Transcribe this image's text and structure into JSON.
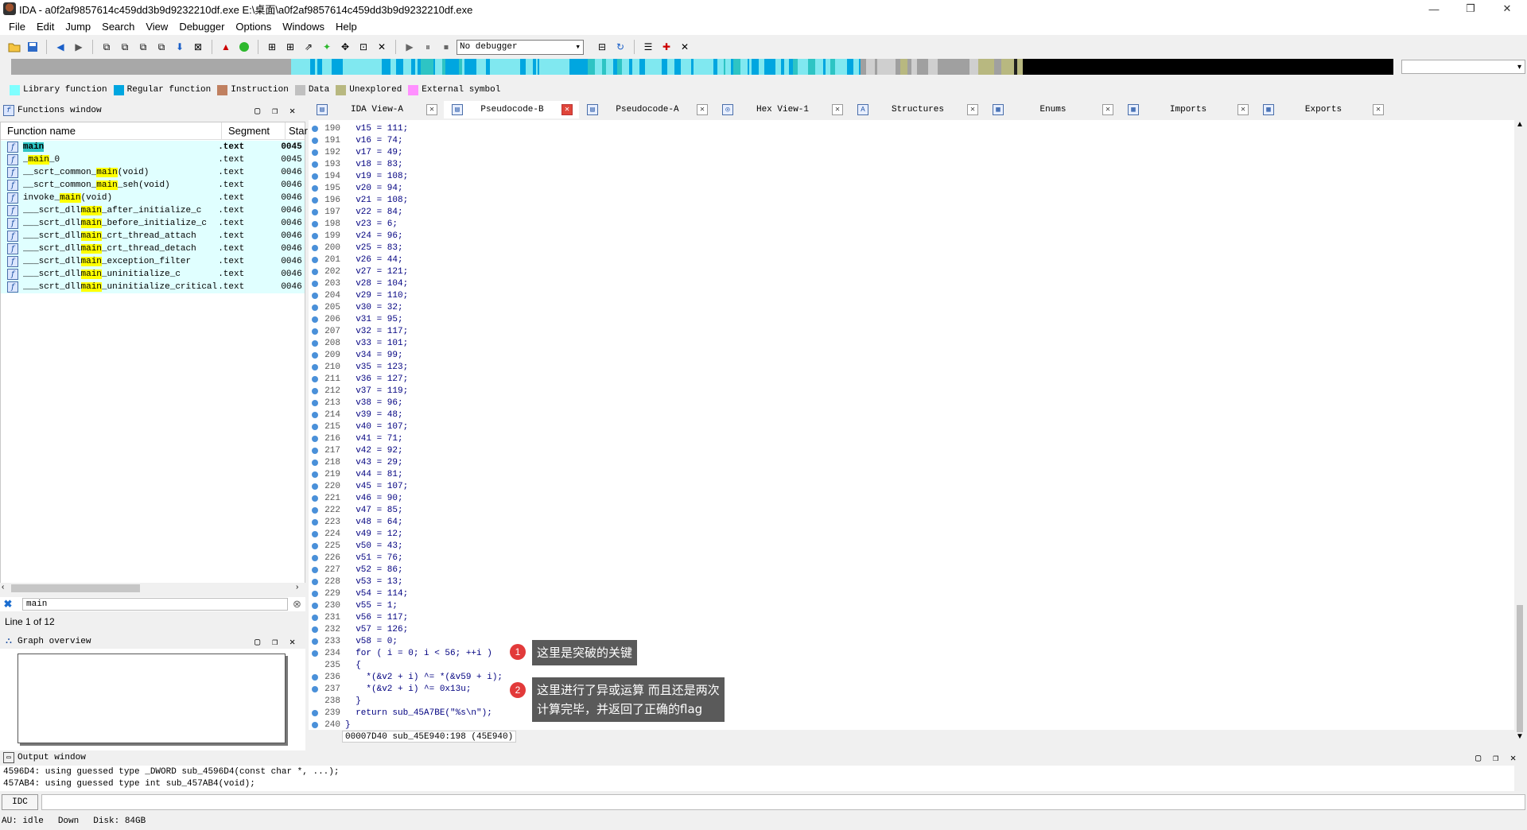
{
  "window": {
    "title": "IDA - a0f2af9857614c459dd3b9d9232210df.exe E:\\桌面\\a0f2af9857614c459dd3b9d9232210df.exe",
    "minimize": "—",
    "restore": "❐",
    "close": "✕"
  },
  "menu": [
    "File",
    "Edit",
    "Jump",
    "Search",
    "View",
    "Debugger",
    "Options",
    "Windows",
    "Help"
  ],
  "toolbar": {
    "debugger_select": "No debugger"
  },
  "legend": [
    {
      "label": "Library function",
      "color": "#80ffff"
    },
    {
      "label": "Regular function",
      "color": "#00a6e0"
    },
    {
      "label": "Instruction",
      "color": "#c08060"
    },
    {
      "label": "Data",
      "color": "#c0c0c0"
    },
    {
      "label": "Unexplored",
      "color": "#b8b880"
    },
    {
      "label": "External symbol",
      "color": "#ff90ff"
    }
  ],
  "functions_window": {
    "title": "Functions window",
    "columns": [
      "Function name",
      "Segment",
      "Star"
    ],
    "rows": [
      {
        "pre": "",
        "hl": "main",
        "post": "",
        "segment": ".text",
        "start": "0045",
        "bold": true
      },
      {
        "pre": "_",
        "hl": "main",
        "post": "_0",
        "segment": ".text",
        "start": "0045",
        "bold": false
      },
      {
        "pre": "__scrt_common_",
        "hl": "main",
        "post": "(void)",
        "segment": ".text",
        "start": "0046",
        "bold": false
      },
      {
        "pre": "__scrt_common_",
        "hl": "main",
        "post": "_seh(void)",
        "segment": ".text",
        "start": "0046",
        "bold": false
      },
      {
        "pre": "invoke_",
        "hl": "main",
        "post": "(void)",
        "segment": ".text",
        "start": "0046",
        "bold": false
      },
      {
        "pre": "___scrt_dll",
        "hl": "main",
        "post": "_after_initialize_c",
        "segment": ".text",
        "start": "0046",
        "bold": false
      },
      {
        "pre": "___scrt_dll",
        "hl": "main",
        "post": "_before_initialize_c",
        "segment": ".text",
        "start": "0046",
        "bold": false
      },
      {
        "pre": "___scrt_dll",
        "hl": "main",
        "post": "_crt_thread_attach",
        "segment": ".text",
        "start": "0046",
        "bold": false
      },
      {
        "pre": "___scrt_dll",
        "hl": "main",
        "post": "_crt_thread_detach",
        "segment": ".text",
        "start": "0046",
        "bold": false
      },
      {
        "pre": "___scrt_dll",
        "hl": "main",
        "post": "_exception_filter",
        "segment": ".text",
        "start": "0046",
        "bold": false
      },
      {
        "pre": "___scrt_dll",
        "hl": "main",
        "post": "_uninitialize_c",
        "segment": ".text",
        "start": "0046",
        "bold": false
      },
      {
        "pre": "___scrt_dll",
        "hl": "main",
        "post": "_uninitialize_critical",
        "segment": ".text",
        "start": "0046",
        "bold": false
      }
    ],
    "filter_value": "main",
    "line_count": "Line 1 of 12"
  },
  "graph_overview": {
    "title": "Graph overview"
  },
  "tabs": [
    {
      "label": "IDA View-A",
      "icon": "▤",
      "active": false
    },
    {
      "label": "Pseudocode-B",
      "icon": "▤",
      "active": true
    },
    {
      "label": "Pseudocode-A",
      "icon": "▤",
      "active": false
    },
    {
      "label": "Hex View-1",
      "icon": "◎",
      "active": false
    },
    {
      "label": "Structures",
      "icon": "A",
      "active": false
    },
    {
      "label": "Enums",
      "icon": "▦",
      "active": false
    },
    {
      "label": "Imports",
      "icon": "▦",
      "active": false
    },
    {
      "label": "Exports",
      "icon": "▦",
      "active": false
    }
  ],
  "code": [
    {
      "n": "190",
      "t": "  v15 = 111;"
    },
    {
      "n": "191",
      "t": "  v16 = 74;"
    },
    {
      "n": "192",
      "t": "  v17 = 49;"
    },
    {
      "n": "193",
      "t": "  v18 = 83;"
    },
    {
      "n": "194",
      "t": "  v19 = 108;"
    },
    {
      "n": "195",
      "t": "  v20 = 94;"
    },
    {
      "n": "196",
      "t": "  v21 = 108;"
    },
    {
      "n": "197",
      "t": "  v22 = 84;"
    },
    {
      "n": "198",
      "t": "  v23 = 6;"
    },
    {
      "n": "199",
      "t": "  v24 = 96;"
    },
    {
      "n": "200",
      "t": "  v25 = 83;"
    },
    {
      "n": "201",
      "t": "  v26 = 44;"
    },
    {
      "n": "202",
      "t": "  v27 = 121;"
    },
    {
      "n": "203",
      "t": "  v28 = 104;"
    },
    {
      "n": "204",
      "t": "  v29 = 110;"
    },
    {
      "n": "205",
      "t": "  v30 = 32;"
    },
    {
      "n": "206",
      "t": "  v31 = 95;"
    },
    {
      "n": "207",
      "t": "  v32 = 117;"
    },
    {
      "n": "208",
      "t": "  v33 = 101;"
    },
    {
      "n": "209",
      "t": "  v34 = 99;"
    },
    {
      "n": "210",
      "t": "  v35 = 123;"
    },
    {
      "n": "211",
      "t": "  v36 = 127;"
    },
    {
      "n": "212",
      "t": "  v37 = 119;"
    },
    {
      "n": "213",
      "t": "  v38 = 96;"
    },
    {
      "n": "214",
      "t": "  v39 = 48;"
    },
    {
      "n": "215",
      "t": "  v40 = 107;"
    },
    {
      "n": "216",
      "t": "  v41 = 71;"
    },
    {
      "n": "217",
      "t": "  v42 = 92;"
    },
    {
      "n": "218",
      "t": "  v43 = 29;"
    },
    {
      "n": "219",
      "t": "  v44 = 81;"
    },
    {
      "n": "220",
      "t": "  v45 = 107;"
    },
    {
      "n": "221",
      "t": "  v46 = 90;"
    },
    {
      "n": "222",
      "t": "  v47 = 85;"
    },
    {
      "n": "223",
      "t": "  v48 = 64;"
    },
    {
      "n": "224",
      "t": "  v49 = 12;"
    },
    {
      "n": "225",
      "t": "  v50 = 43;"
    },
    {
      "n": "226",
      "t": "  v51 = 76;"
    },
    {
      "n": "227",
      "t": "  v52 = 86;"
    },
    {
      "n": "228",
      "t": "  v53 = 13;"
    },
    {
      "n": "229",
      "t": "  v54 = 114;"
    },
    {
      "n": "230",
      "t": "  v55 = 1;"
    },
    {
      "n": "231",
      "t": "  v56 = 117;"
    },
    {
      "n": "232",
      "t": "  v57 = 126;"
    },
    {
      "n": "233",
      "t": "  v58 = 0;"
    },
    {
      "n": "234",
      "t": "  for ( i = 0; i < 56; ++i )"
    },
    {
      "n": "235",
      "t": "  {"
    },
    {
      "n": "236",
      "t": "    *(&v2 + i) ^= *(&v59 + i);"
    },
    {
      "n": "237",
      "t": "    *(&v2 + i) ^= 0x13u;"
    },
    {
      "n": "238",
      "t": "  }"
    },
    {
      "n": "239",
      "t": "  return sub_45A7BE(\"%s\\n\");"
    },
    {
      "n": "240",
      "t": "}"
    }
  ],
  "code_status": "00007D40 sub_45E940:198 (45E940)",
  "annotations": [
    {
      "num": "1",
      "text": "这里是突破的关键"
    },
    {
      "num": "2",
      "line1": "这里进行了异或运算 而且还是两次",
      "line2": "计算完毕，并返回了正确的flag"
    }
  ],
  "output": {
    "title": "Output window",
    "lines": [
      "4596D4: using guessed type _DWORD sub_4596D4(const char *, ...);",
      "457AB4: using guessed type int sub_457AB4(void);"
    ],
    "idc_label": "IDC"
  },
  "status": {
    "au": "AU:  idle",
    "dir": "Down",
    "disk": "Disk: 84GB"
  }
}
